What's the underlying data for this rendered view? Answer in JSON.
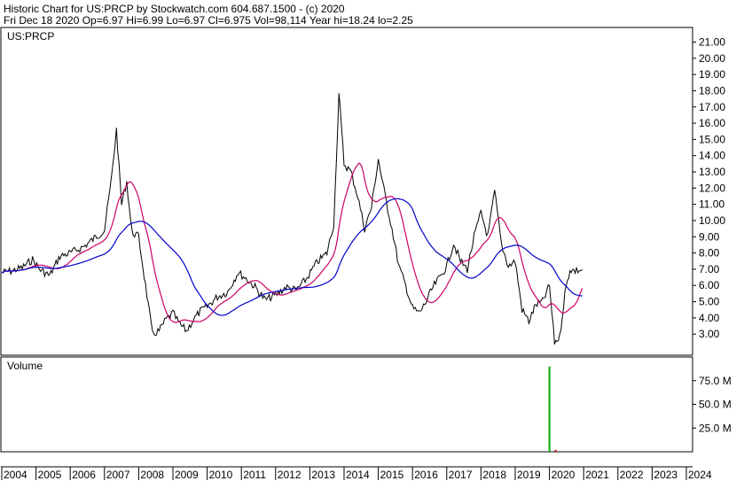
{
  "header": {
    "line1": "Historic Chart for US:PRCP by Stockwatch.com 604.687.1500 - (c) 2020",
    "line2": "Fri Dec 18 2020   Op=6.97  Hi=6.99  Lo=6.97  Cl=6.975  Vol=98,114  Year hi=18.24  lo=2.25"
  },
  "colors": {
    "background": "#ffffff",
    "price": "#000000",
    "ma_short": "#cc0066",
    "ma_long": "#0000cc",
    "volume_bar": "#00aa00",
    "volume_bar_small": "#cc0000"
  },
  "chart_data": [
    {
      "type": "line",
      "title": "US:PRCP",
      "ylim": [
        2.25,
        21.5
      ],
      "xlim": [
        2004,
        2024
      ],
      "yticks": [
        "3.00",
        "4.00",
        "5.00",
        "6.00",
        "7.00",
        "8.00",
        "9.00",
        "10.00",
        "11.00",
        "12.00",
        "13.00",
        "14.00",
        "15.00",
        "16.00",
        "17.00",
        "18.00",
        "19.00",
        "20.00",
        "21.00"
      ],
      "xticks": [
        "2004",
        "2005",
        "2006",
        "2007",
        "2008",
        "2009",
        "2010",
        "2011",
        "2012",
        "2013",
        "2014",
        "2015",
        "2016",
        "2017",
        "2018",
        "2019",
        "2020",
        "2021",
        "2022",
        "2023",
        "2024"
      ],
      "grid": false,
      "series": [
        {
          "x": [
            2004.0,
            2004.3,
            2004.6,
            2004.9,
            2005.1,
            2005.4,
            2005.7,
            2006.0,
            2006.4,
            2006.7,
            2007.0,
            2007.2,
            2007.35,
            2007.5,
            2007.65,
            2007.8,
            2008.0,
            2008.2,
            2008.4,
            2008.6,
            2008.8,
            2009.0,
            2009.2,
            2009.4,
            2009.6,
            2009.8,
            2010.0,
            2010.3,
            2010.6,
            2010.9,
            2011.1,
            2011.4,
            2011.7,
            2012.0,
            2012.3,
            2012.6,
            2012.9,
            2013.2,
            2013.5,
            2013.7,
            2013.85,
            2014.0,
            2014.2,
            2014.4,
            2014.6,
            2014.8,
            2015.0,
            2015.2,
            2015.4,
            2015.6,
            2015.8,
            2016.0,
            2016.2,
            2016.4,
            2016.6,
            2016.8,
            2017.0,
            2017.2,
            2017.4,
            2017.6,
            2017.8,
            2018.0,
            2018.2,
            2018.4,
            2018.6,
            2018.8,
            2019.0,
            2019.2,
            2019.4,
            2019.6,
            2019.8,
            2020.0,
            2020.15,
            2020.3,
            2020.45,
            2020.6,
            2020.75,
            2020.96
          ],
          "values": [
            6.8,
            6.9,
            7.1,
            7.6,
            7.0,
            6.6,
            7.8,
            8.0,
            8.4,
            8.9,
            9.4,
            12.5,
            15.6,
            11.0,
            12.4,
            9.3,
            9.0,
            6.0,
            3.0,
            3.2,
            3.9,
            4.3,
            3.6,
            3.2,
            3.9,
            4.4,
            4.7,
            5.3,
            5.6,
            6.8,
            6.5,
            5.9,
            5.1,
            5.4,
            5.9,
            5.7,
            6.4,
            7.4,
            8.0,
            9.8,
            17.8,
            13.5,
            13.0,
            11.5,
            9.5,
            10.8,
            13.8,
            11.5,
            9.5,
            7.2,
            6.0,
            4.6,
            4.3,
            5.0,
            5.9,
            6.5,
            7.2,
            8.6,
            7.5,
            7.0,
            9.0,
            10.5,
            9.0,
            11.8,
            8.5,
            7.2,
            7.5,
            4.5,
            3.8,
            4.8,
            5.0,
            6.0,
            2.5,
            2.8,
            5.5,
            7.0,
            6.9,
            6.975
          ]
        }
      ]
    },
    {
      "type": "bar",
      "title": "Volume",
      "ylim": [
        0,
        100
      ],
      "yticks": [
        "25.0 M",
        "50.0 M",
        "75.0 M"
      ],
      "series": [
        {
          "x": [
            2020.0,
            2020.18
          ],
          "values": [
            90,
            2
          ]
        }
      ]
    }
  ]
}
